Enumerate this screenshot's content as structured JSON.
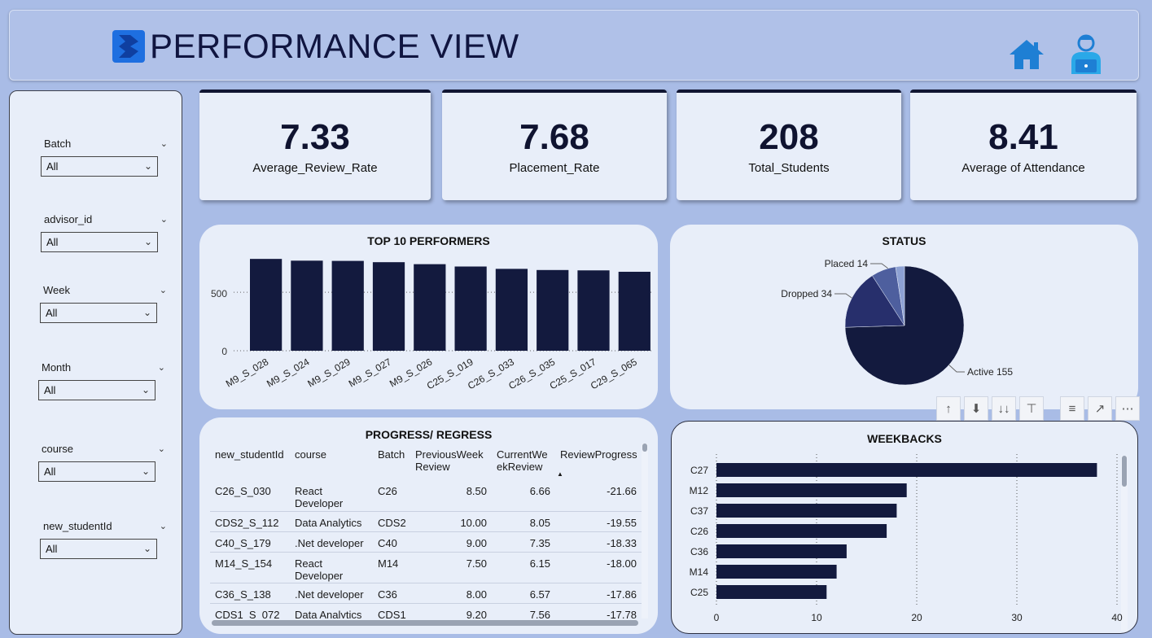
{
  "header": {
    "title": "PERFORMANCE VIEW",
    "home_icon": "home-icon",
    "user_icon": "user-laptop-icon"
  },
  "filters": [
    {
      "label": "Batch",
      "value": "All"
    },
    {
      "label": "advisor_id",
      "value": "All"
    },
    {
      "label": "Week",
      "value": "All"
    },
    {
      "label": "Month",
      "value": "All"
    },
    {
      "label": "course",
      "value": "All"
    },
    {
      "label": "new_studentId",
      "value": "All"
    }
  ],
  "kpis": [
    {
      "value": "7.33",
      "label": "Average_Review_Rate"
    },
    {
      "value": "7.68",
      "label": "Placement_Rate"
    },
    {
      "value": "208",
      "label": "Total_Students"
    },
    {
      "value": "8.41",
      "label": "Average of Attendance"
    }
  ],
  "top_performers": {
    "title": "TOP 10 PERFORMERS",
    "ticks": [
      "500",
      "0"
    ]
  },
  "status": {
    "title": "STATUS",
    "labels": [
      "Placed 14",
      "Dropped 34",
      "Active 155"
    ]
  },
  "progress": {
    "title": "PROGRESS/ REGRESS",
    "columns": [
      "new_studentId",
      "course",
      "Batch",
      "PreviousWeek Review",
      "CurrentWe ekReview",
      "ReviewProgress"
    ],
    "rows": [
      [
        "C26_S_030",
        "React Developer",
        "C26",
        "8.50",
        "6.66",
        "-21.66"
      ],
      [
        "CDS2_S_112",
        "Data Analytics",
        "CDS2",
        "10.00",
        "8.05",
        "-19.55"
      ],
      [
        "C40_S_179",
        ".Net developer",
        "C40",
        "9.00",
        "7.35",
        "-18.33"
      ],
      [
        "M14_S_154",
        "React Developer",
        "M14",
        "7.50",
        "6.15",
        "-18.00"
      ],
      [
        "C36_S_138",
        ".Net developer",
        "C36",
        "8.00",
        "6.57",
        "-17.86"
      ],
      [
        "CDS1_S_072",
        "Data Analytics",
        "CDS1",
        "9.20",
        "7.56",
        "-17.78"
      ]
    ]
  },
  "weekbacks": {
    "title": "WEEKBACKS",
    "ticks": [
      "0",
      "10",
      "20",
      "30",
      "40"
    ]
  },
  "toolbar": [
    "arrow-up-icon",
    "drill-down-icon",
    "expand-next-level-icon",
    "expand-hierarchy-icon",
    "filter-icon",
    "focus-mode-icon",
    "more-options-icon"
  ],
  "chart_data": [
    {
      "type": "bar",
      "title": "TOP 10 PERFORMERS",
      "categories": [
        "M9_S_028",
        "M9_S_024",
        "M9_S_029",
        "M9_S_027",
        "M9_S_026",
        "C25_S_019",
        "C26_S_033",
        "C26_S_035",
        "C25_S_017",
        "C29_S_065"
      ],
      "values": [
        785,
        770,
        768,
        757,
        740,
        720,
        700,
        690,
        687,
        675
      ],
      "ylim": [
        0,
        800
      ],
      "yticks": [
        0,
        500
      ],
      "color": "#131a3e"
    },
    {
      "type": "pie",
      "title": "STATUS",
      "categories": [
        "Active",
        "Dropped",
        "Placed",
        "Other"
      ],
      "values": [
        155,
        34,
        14,
        5
      ],
      "colors": [
        "#131a3e",
        "#272f6c",
        "#4e5f9e",
        "#8da1d3"
      ]
    },
    {
      "type": "bar",
      "orientation": "horizontal",
      "title": "WEEKBACKS",
      "categories": [
        "C27",
        "M12",
        "C37",
        "C26",
        "C36",
        "M14",
        "C25"
      ],
      "values": [
        38,
        19,
        18,
        17,
        13,
        12,
        11
      ],
      "xlim": [
        0,
        40
      ],
      "xticks": [
        0,
        10,
        20,
        30,
        40
      ],
      "color": "#131a3e"
    }
  ]
}
